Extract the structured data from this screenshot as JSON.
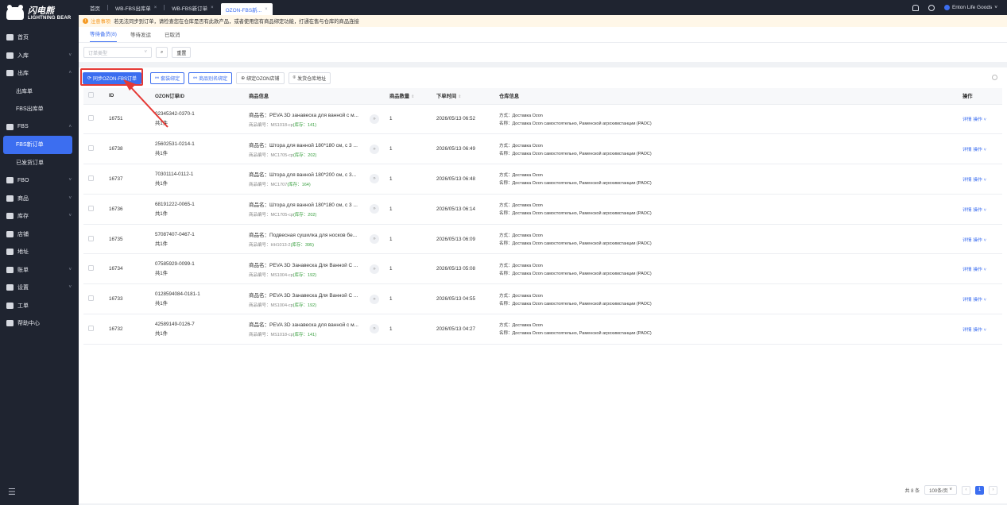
{
  "brand": {
    "name_cn": "闪电熊",
    "name_en": "LIGHTNING BEAR"
  },
  "sidebar": {
    "items": [
      {
        "label": "首页",
        "icon": "home-icon"
      },
      {
        "label": "入库",
        "icon": "inbound-icon",
        "chevron": "˅"
      },
      {
        "label": "出库",
        "icon": "outbound-icon",
        "chevron": "˄"
      },
      {
        "label": "出库单",
        "sub": true
      },
      {
        "label": "FBS出库单",
        "sub": true
      },
      {
        "label": "FBS",
        "icon": "fbs-icon",
        "chevron": "˄"
      },
      {
        "label": "FBS新订单",
        "sub": true,
        "active": true
      },
      {
        "label": "已发货订单",
        "sub": true
      },
      {
        "label": "FBO",
        "icon": "fbo-icon",
        "chevron": "˅"
      },
      {
        "label": "商品",
        "icon": "goods-icon",
        "chevron": "˅"
      },
      {
        "label": "库存",
        "icon": "stock-icon",
        "chevron": "˅"
      },
      {
        "label": "店铺",
        "icon": "shop-icon"
      },
      {
        "label": "地址",
        "icon": "location-icon"
      },
      {
        "label": "账单",
        "icon": "bill-icon",
        "chevron": "˅"
      },
      {
        "label": "设置",
        "icon": "settings-icon",
        "chevron": "˅"
      },
      {
        "label": "工单",
        "icon": "ticket-icon"
      },
      {
        "label": "帮助中心",
        "icon": "help-icon"
      }
    ]
  },
  "tabs": [
    {
      "label": "首页"
    },
    {
      "label": "WB-FBS出库单",
      "close": "×"
    },
    {
      "label": "WB-FBS新订单",
      "close": "×"
    },
    {
      "label": "OZON-FBS新...",
      "close": "×",
      "active": true
    }
  ],
  "topbar": {
    "user": "Enton Life Goods",
    "user_chev": "˅"
  },
  "notice": {
    "label": "注意事项",
    "text": "若无法同步到订单，请检查您在仓库是否有此款产品，或者使用您有商品绑定功能，打通在售与仓库的商品连接"
  },
  "subtabs": [
    "等待备货(8)",
    "等待发运",
    "已取消"
  ],
  "filter": {
    "placeholder": "订单类型",
    "search_icon": "⌕",
    "reset": "重置"
  },
  "actions": {
    "sync": "同步OZON-FBS订单",
    "set_bind": "套装绑定",
    "alias_bind": "商品别名绑定",
    "bind_shop": "绑定OZON店铺",
    "ship_addr": "发货仓库地址"
  },
  "columns": {
    "id": "ID",
    "order_id": "OZON订单ID",
    "product": "商品信息",
    "qty": "商品数量",
    "time": "下单时间",
    "warehouse": "仓库信息",
    "op": "操作"
  },
  "labels": {
    "name_prefix": "商品名：",
    "code_prefix": "商品编号：",
    "stock_prefix": "(库存：",
    "stock_suffix": ")",
    "pieces": "共1件",
    "method_prefix": "方式：",
    "wh_prefix": "名称：",
    "detail": "详情",
    "op": "操作 ˅"
  },
  "rows": [
    {
      "id": "16751",
      "order": "02345342-0370-1",
      "name": "PEVA 3D занавеска для ванной с м...",
      "code": "MS1018-cp",
      "stock": "141",
      "qty": "1",
      "time": "2026/05/13 06:52",
      "method": "Доставка Ozon",
      "wh": "Доставка Ozon самостоятельно, Раменской агрохимстанции (РАОС)"
    },
    {
      "id": "16738",
      "order": "25602531-0214-1",
      "name": "Штора для ванной 180*180 см, с 3 ...",
      "code": "MC1705-cp",
      "stock": "202",
      "qty": "1",
      "time": "2026/05/13 06:49",
      "method": "Доставка Ozon",
      "wh": "Доставка Ozon самостоятельно, Раменской агрохимстанции (РАОС)"
    },
    {
      "id": "16737",
      "order": "70301114-0112-1",
      "name": "Штора для ванной 180*200 см, с 3...",
      "code": "MC1707",
      "stock": "164",
      "qty": "1",
      "time": "2026/05/13 06:48",
      "method": "Доставка Ozon",
      "wh": "Доставка Ozon самостоятельно, Раменской агрохимстанции (РАОС)"
    },
    {
      "id": "16736",
      "order": "68191222-0065-1",
      "name": "Штора для ванной 180*180 см, с 3 ...",
      "code": "MC1705-cp",
      "stock": "202",
      "qty": "1",
      "time": "2026/05/13 06:14",
      "method": "Доставка Ozon",
      "wh": "Доставка Ozon самостоятельно, Раменской агрохимстанции (РАОС)"
    },
    {
      "id": "16735",
      "order": "57087407-0467-1",
      "name": "Подвесная сушилка для носков бе...",
      "code": "HH1013-2",
      "stock": "395",
      "qty": "1",
      "time": "2026/05/13 06:09",
      "method": "Доставка Ozon",
      "wh": "Доставка Ozon самостоятельно, Раменской агрохимстанции (РАОС)"
    },
    {
      "id": "16734",
      "order": "07585929-0099-1",
      "name": "PEVA 3D Занавеска Для Ванной С ...",
      "code": "MS1004-cp",
      "stock": "192",
      "qty": "1",
      "time": "2026/05/13 05:08",
      "method": "Доставка Ozon",
      "wh": "Доставка Ozon самостоятельно, Раменской агрохимстанции (РАОС)"
    },
    {
      "id": "16733",
      "order": "0128594084-0181-1",
      "name": "PEVA 3D Занавеска Для Ванной С ...",
      "code": "MS1004-cp",
      "stock": "192",
      "qty": "1",
      "time": "2026/05/13 04:55",
      "method": "Доставка Ozon",
      "wh": "Доставка Ozon самостоятельно, Раменской агрохимстанции (РАОС)"
    },
    {
      "id": "16732",
      "order": "42589149-0126-7",
      "name": "PEVA 3D занавеска для ванной с м...",
      "code": "MS1018-cp",
      "stock": "141",
      "qty": "1",
      "time": "2026/05/13 04:27",
      "method": "Доставка Ozon",
      "wh": "Доставка Ozon самостоятельно, Раменской агрохимстанции (РАОС)"
    }
  ],
  "pager": {
    "total": "共 8 条",
    "size": "100条/页",
    "size_chev": "˅",
    "page": "1",
    "prev": "‹",
    "next": "›"
  },
  "colors": {
    "accent": "#3c6ef0",
    "sidebar": "#1f2430",
    "highlight": "#e53935",
    "stock": "#3aa040"
  }
}
